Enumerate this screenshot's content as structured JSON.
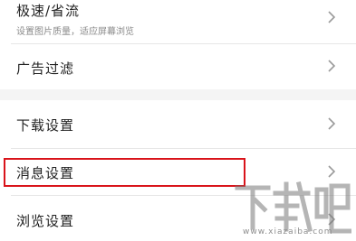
{
  "settings": {
    "group1": [
      {
        "label": "极速/省流",
        "sublabel": "设置图片质量，适应屏幕浏览"
      },
      {
        "label": "广告过滤"
      }
    ],
    "group2": [
      {
        "label": "下载设置"
      },
      {
        "label": "消息设置"
      },
      {
        "label": "浏览设置"
      }
    ]
  },
  "watermark": {
    "brand": "下载吧",
    "url": "www.xiazaiba.com"
  },
  "colors": {
    "highlight": "#d9141b",
    "chevron": "#9a9a9a",
    "background": "#f4f4f4"
  },
  "icons": {
    "row_arrow": "chevron-right-icon"
  }
}
